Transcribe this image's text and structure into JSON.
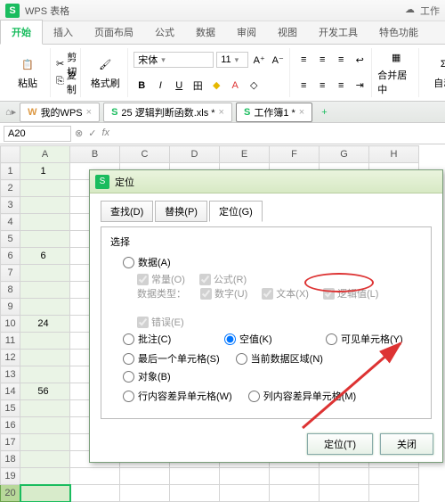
{
  "titlebar": {
    "app": "WPS 表格",
    "workbtn": "工作"
  },
  "tabs": [
    "开始",
    "插入",
    "页面布局",
    "公式",
    "数据",
    "审阅",
    "视图",
    "开发工具",
    "特色功能"
  ],
  "ribbon": {
    "paste": "粘贴",
    "cut": "剪切",
    "copy": "复制",
    "fmtpaint": "格式刷",
    "font": "宋体",
    "size": "11",
    "merge": "合并居中",
    "autosum": "自动"
  },
  "doc_tabs": [
    {
      "icon": "W",
      "label": "我的WPS",
      "color": "#d94"
    },
    {
      "icon": "S",
      "label": "25   逻辑判断函数.xls *",
      "color": "#1abc5e"
    },
    {
      "icon": "S",
      "label": "工作簿1 *",
      "color": "#1abc5e",
      "active": true
    }
  ],
  "namebox": "A20",
  "columns": [
    "A",
    "B",
    "C",
    "D",
    "E",
    "F",
    "G",
    "H"
  ],
  "rows": 20,
  "cells": {
    "1": "1",
    "6": "6",
    "10": "24",
    "14": "56"
  },
  "dialog": {
    "title": "定位",
    "tabs": [
      "查找(D)",
      "替换(P)",
      "定位(G)"
    ],
    "select_label": "选择",
    "data": "数据(A)",
    "constants": "常量(O)",
    "formulas": "公式(R)",
    "datatype": "数据类型：",
    "number": "数字(U)",
    "text": "文本(X)",
    "logic": "逻辑值(L)",
    "error": "错误(E)",
    "comment": "批注(C)",
    "blank": "空值(K)",
    "visible": "可见单元格(Y)",
    "lastcell": "最后一个单元格(S)",
    "curdata": "当前数据区域(N)",
    "obj": "对象(B)",
    "rowdiff": "行内容差异单元格(W)",
    "coldiff": "列内容差异单元格(M)",
    "go_btn": "定位(T)",
    "close_btn": "关闭"
  }
}
